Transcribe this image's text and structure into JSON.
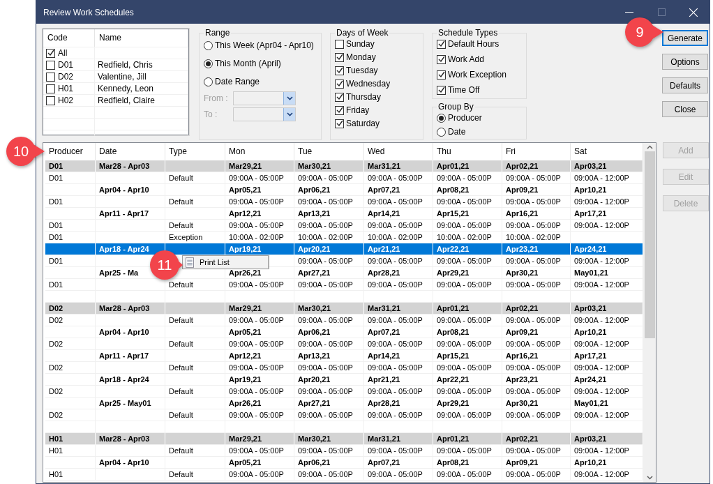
{
  "window": {
    "title": "Review Work Schedules"
  },
  "code_list": {
    "columns": [
      "Code",
      "Name"
    ],
    "rows": [
      {
        "code": "All",
        "checked": true
      },
      {
        "code": "D01",
        "name": "Redfield, Chris",
        "checked": false
      },
      {
        "code": "D02",
        "name": "Valentine, Jill",
        "checked": false
      },
      {
        "code": "H01",
        "name": "Kennedy, Leon",
        "checked": false
      },
      {
        "code": "H02",
        "name": "Redfield, Claire",
        "checked": false
      }
    ]
  },
  "range": {
    "title": "Range",
    "options": [
      {
        "label": "This Week (Apr04 - Apr10)",
        "selected": false
      },
      {
        "label": "This Month (April)",
        "selected": true
      },
      {
        "label": "Date Range",
        "selected": false
      }
    ],
    "fields": [
      {
        "label": "From :",
        "disabled": true
      },
      {
        "label": "To :",
        "disabled": true
      }
    ]
  },
  "days_of_week": {
    "title": "Days of Week",
    "items": [
      {
        "label": "Sunday",
        "checked": false
      },
      {
        "label": "Monday",
        "checked": true
      },
      {
        "label": "Tuesday",
        "checked": true
      },
      {
        "label": "Wednesday",
        "checked": true
      },
      {
        "label": "Thursday",
        "checked": true
      },
      {
        "label": "Friday",
        "checked": true
      },
      {
        "label": "Saturday",
        "checked": true
      }
    ]
  },
  "schedule_types": {
    "title": "Schedule Types",
    "items": [
      {
        "label": "Default Hours",
        "checked": true
      },
      {
        "label": "Work Add",
        "checked": true
      },
      {
        "label": "Work Exception",
        "checked": true
      },
      {
        "label": "Time Off",
        "checked": true
      }
    ]
  },
  "group_by": {
    "title": "Group By",
    "options": [
      {
        "label": "Producer",
        "selected": true
      },
      {
        "label": "Date",
        "selected": false
      }
    ]
  },
  "buttons": [
    {
      "label": "Generate",
      "focused": true,
      "disabled": false
    },
    {
      "label": "Options",
      "focused": false,
      "disabled": false
    },
    {
      "label": "Defaults",
      "focused": false,
      "disabled": false
    },
    {
      "label": "Close",
      "focused": false,
      "disabled": false
    }
  ],
  "grid_buttons": [
    {
      "label": "Add",
      "disabled": true
    },
    {
      "label": "Edit",
      "disabled": true
    },
    {
      "label": "Delete",
      "disabled": true
    }
  ],
  "table": {
    "columns": [
      "Producer",
      "Date",
      "Type",
      "Mon",
      "Tue",
      "Wed",
      "Thu",
      "Fri",
      "Sat"
    ],
    "rows": [
      {
        "kind": "group",
        "selected": false,
        "cells": [
          "D01",
          "Mar28 - Apr03",
          null,
          "Mar29,21",
          "Mar30,21",
          "Mar31,21",
          "Apr01,21",
          "Apr02,21",
          "Apr03,21"
        ]
      },
      {
        "kind": "detail",
        "selected": false,
        "cells": [
          "D01",
          null,
          "Default",
          "09:00A - 05:00P",
          "09:00A - 05:00P",
          "09:00A - 05:00P",
          "09:00A - 05:00P",
          "09:00A - 05:00P",
          "09:00A - 12:00P"
        ]
      },
      {
        "kind": "week",
        "selected": false,
        "cells": [
          null,
          "Apr04 - Apr10",
          null,
          "Apr05,21",
          "Apr06,21",
          "Apr07,21",
          "Apr08,21",
          "Apr09,21",
          "Apr10,21"
        ]
      },
      {
        "kind": "detail",
        "selected": false,
        "cells": [
          "D01",
          null,
          "Default",
          "09:00A - 05:00P",
          "09:00A - 05:00P",
          "09:00A - 05:00P",
          "09:00A - 05:00P",
          "09:00A - 05:00P",
          "09:00A - 12:00P"
        ]
      },
      {
        "kind": "week",
        "selected": false,
        "cells": [
          null,
          "Apr11 - Apr17",
          null,
          "Apr12,21",
          "Apr13,21",
          "Apr14,21",
          "Apr15,21",
          "Apr16,21",
          "Apr17,21"
        ]
      },
      {
        "kind": "detail",
        "selected": false,
        "cells": [
          "D01",
          null,
          "Default",
          "09:00A - 05:00P",
          "09:00A - 05:00P",
          "09:00A - 05:00P",
          "09:00A - 05:00P",
          "09:00A - 05:00P",
          "09:00A - 12:00P"
        ]
      },
      {
        "kind": "detail",
        "selected": false,
        "cells": [
          "D01",
          null,
          "Exception",
          "10:00A - 02:00P",
          "10:00A - 02:00P",
          "10:00A - 02:00P",
          "10:00A - 02:00P",
          "10:00A - 02:00P",
          null
        ]
      },
      {
        "kind": "week",
        "selected": true,
        "cells": [
          null,
          "Apr18 - Apr24",
          null,
          "Apr19,21",
          "Apr20,21",
          "Apr21,21",
          "Apr22,21",
          "Apr23,21",
          "Apr24,21"
        ]
      },
      {
        "kind": "detail",
        "selected": false,
        "cells": [
          "D01",
          null,
          null,
          null,
          "09:00A - 05:00P",
          "09:00A - 05:00P",
          "09:00A - 05:00P",
          "09:00A - 05:00P",
          "09:00A - 12:00P"
        ]
      },
      {
        "kind": "week",
        "selected": false,
        "cells": [
          null,
          "Apr25 - Ma",
          null,
          "Apr26,21",
          "Apr27,21",
          "Apr28,21",
          "Apr29,21",
          "Apr30,21",
          "May01,21"
        ]
      },
      {
        "kind": "detail",
        "selected": false,
        "cells": [
          "D01",
          null,
          "Default",
          "09:00A - 05:00P",
          "09:00A - 05:00P",
          "09:00A - 05:00P",
          "09:00A - 05:00P",
          "09:00A - 05:00P",
          "09:00A - 12:00P"
        ]
      },
      {
        "kind": "blank",
        "selected": false,
        "cells": []
      },
      {
        "kind": "group",
        "selected": false,
        "cells": [
          "D02",
          "Mar28 - Apr03",
          null,
          "Mar29,21",
          "Mar30,21",
          "Mar31,21",
          "Apr01,21",
          "Apr02,21",
          "Apr03,21"
        ]
      },
      {
        "kind": "detail",
        "selected": false,
        "cells": [
          "D02",
          null,
          "Default",
          "09:00A - 05:00P",
          "09:00A - 05:00P",
          "09:00A - 05:00P",
          "09:00A - 05:00P",
          "09:00A - 05:00P",
          "09:00A - 12:00P"
        ]
      },
      {
        "kind": "week",
        "selected": false,
        "cells": [
          null,
          "Apr04 - Apr10",
          null,
          "Apr05,21",
          "Apr06,21",
          "Apr07,21",
          "Apr08,21",
          "Apr09,21",
          "Apr10,21"
        ]
      },
      {
        "kind": "detail",
        "selected": false,
        "cells": [
          "D02",
          null,
          "Default",
          "09:00A - 05:00P",
          "09:00A - 05:00P",
          "09:00A - 05:00P",
          "09:00A - 05:00P",
          "09:00A - 05:00P",
          "09:00A - 12:00P"
        ]
      },
      {
        "kind": "week",
        "selected": false,
        "cells": [
          null,
          "Apr11 - Apr17",
          null,
          "Apr12,21",
          "Apr13,21",
          "Apr14,21",
          "Apr15,21",
          "Apr16,21",
          "Apr17,21"
        ]
      },
      {
        "kind": "detail",
        "selected": false,
        "cells": [
          "D02",
          null,
          "Default",
          "09:00A - 05:00P",
          "09:00A - 05:00P",
          "09:00A - 05:00P",
          "09:00A - 05:00P",
          "09:00A - 05:00P",
          "09:00A - 12:00P"
        ]
      },
      {
        "kind": "week",
        "selected": false,
        "cells": [
          null,
          "Apr18 - Apr24",
          null,
          "Apr19,21",
          "Apr20,21",
          "Apr21,21",
          "Apr22,21",
          "Apr23,21",
          "Apr24,21"
        ]
      },
      {
        "kind": "detail",
        "selected": false,
        "cells": [
          "D02",
          null,
          "Default",
          "09:00A - 05:00P",
          "09:00A - 05:00P",
          "09:00A - 05:00P",
          "09:00A - 05:00P",
          "09:00A - 05:00P",
          "09:00A - 12:00P"
        ]
      },
      {
        "kind": "week",
        "selected": false,
        "cells": [
          null,
          "Apr25 - May01",
          null,
          "Apr26,21",
          "Apr27,21",
          "Apr28,21",
          "Apr29,21",
          "Apr30,21",
          "May01,21"
        ]
      },
      {
        "kind": "detail",
        "selected": false,
        "cells": [
          "D02",
          null,
          "Default",
          "09:00A - 05:00P",
          "09:00A - 05:00P",
          "09:00A - 05:00P",
          "09:00A - 05:00P",
          "09:00A - 05:00P",
          "09:00A - 12:00P"
        ]
      },
      {
        "kind": "blank",
        "selected": false,
        "cells": []
      },
      {
        "kind": "group",
        "selected": false,
        "cells": [
          "H01",
          "Mar28 - Apr03",
          null,
          "Mar29,21",
          "Mar30,21",
          "Mar31,21",
          "Apr01,21",
          "Apr02,21",
          "Apr03,21"
        ]
      },
      {
        "kind": "detail",
        "selected": false,
        "cells": [
          "H01",
          null,
          "Default",
          "09:00A - 05:00P",
          "09:00A - 05:00P",
          "09:00A - 05:00P",
          "09:00A - 05:00P",
          "09:00A - 05:00P",
          "09:00A - 12:00P"
        ]
      },
      {
        "kind": "week",
        "selected": false,
        "cells": [
          null,
          "Apr04 - Apr10",
          null,
          "Apr05,21",
          "Apr06,21",
          "Apr07,21",
          "Apr08,21",
          "Apr09,21",
          "Apr10,21"
        ]
      },
      {
        "kind": "detail",
        "selected": false,
        "cells": [
          "H01",
          null,
          "Default",
          "09:00A - 05:00P",
          "09:00A - 05:00P",
          "09:00A - 05:00P",
          "09:00A - 05:00P",
          "09:00A - 05:00P",
          "09:00A - 12:00P"
        ]
      }
    ]
  },
  "context_menu": {
    "items": [
      {
        "label": "Print List"
      }
    ]
  },
  "callouts": [
    {
      "label": "9"
    },
    {
      "label": "10"
    },
    {
      "label": "11"
    }
  ]
}
